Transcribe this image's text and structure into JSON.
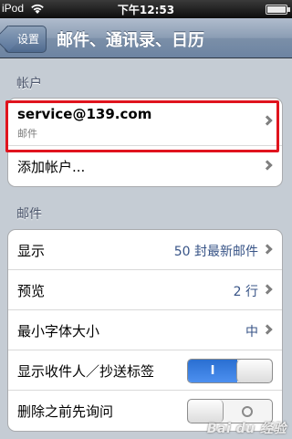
{
  "statusbar": {
    "carrier": "iPod",
    "time": "下午12:53"
  },
  "navbar": {
    "back_label": "设置",
    "title": "邮件、通讯录、日历"
  },
  "accounts_section": {
    "header": "帐户",
    "account": {
      "email": "service@139.com",
      "type": "邮件"
    },
    "add_account_label": "添加帐户..."
  },
  "mail_section": {
    "header": "邮件",
    "rows": [
      {
        "label": "显示",
        "value": "50 封最新邮件"
      },
      {
        "label": "预览",
        "value": "2 行"
      },
      {
        "label": "最小字体大小",
        "value": "中"
      }
    ],
    "show_to_cc": {
      "label": "显示收件人／抄送标签",
      "state": "on",
      "on_text": "I"
    },
    "ask_before_delete": {
      "label": "删除之前先询问",
      "state": "off"
    }
  },
  "colors": {
    "highlight": "#e0141e",
    "toggle_on": "#2a6fd1",
    "value_text": "#385487"
  },
  "watermark": "Bai du 经验"
}
